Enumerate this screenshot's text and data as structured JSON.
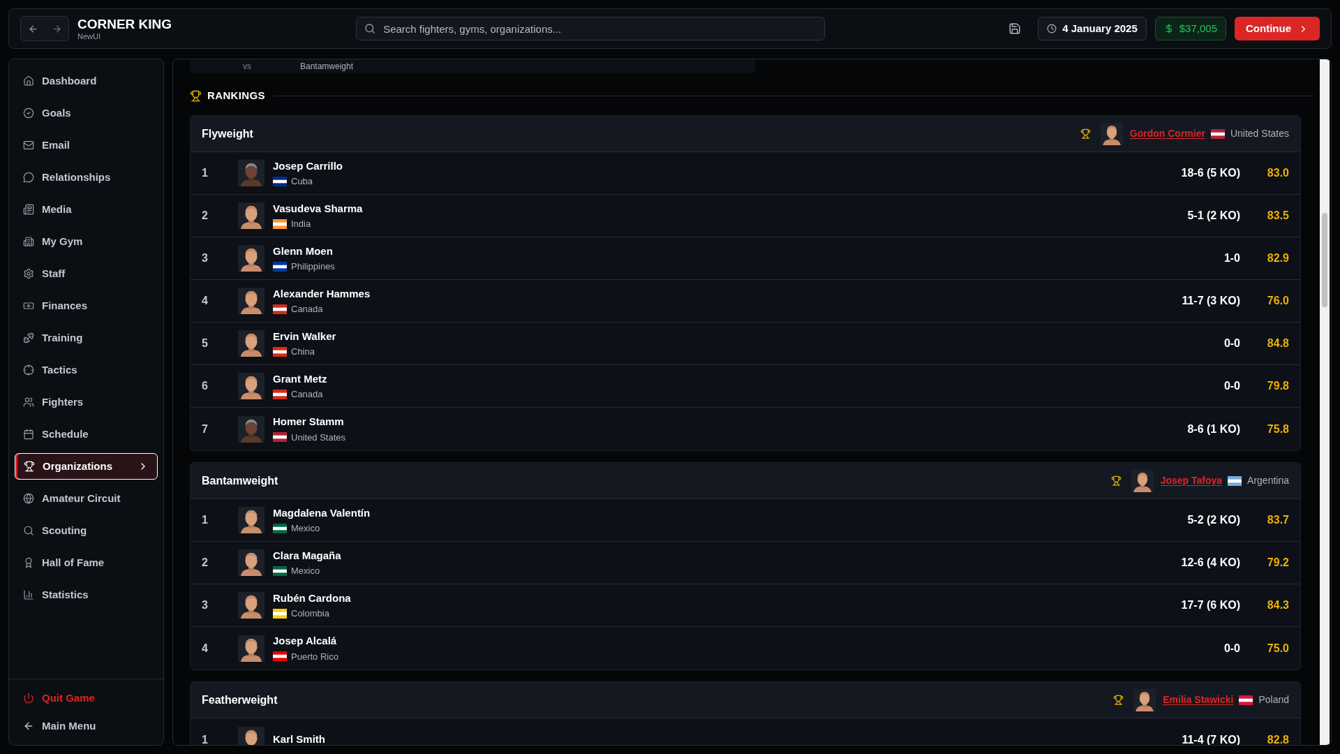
{
  "top_bar": {
    "title": "CORNER KING",
    "subtitle": "NewUI",
    "search": {
      "placeholder": "Search fighters, gyms, organizations..."
    },
    "date": "4 January 2025",
    "money": "$37,005",
    "continue": "Continue"
  },
  "sidebar": {
    "items": [
      {
        "label": "Dashboard",
        "selected": false
      },
      {
        "label": "Goals",
        "selected": false
      },
      {
        "label": "Email",
        "selected": false
      },
      {
        "label": "Relationships",
        "selected": false
      },
      {
        "label": "Media",
        "selected": false
      },
      {
        "label": "My Gym",
        "selected": false
      },
      {
        "label": "Staff",
        "selected": false
      },
      {
        "label": "Finances",
        "selected": false
      },
      {
        "label": "Training",
        "selected": false
      },
      {
        "label": "Tactics",
        "selected": false
      },
      {
        "label": "Fighters",
        "selected": false
      },
      {
        "label": "Schedule",
        "selected": false
      },
      {
        "label": "Organizations",
        "selected": true
      },
      {
        "label": "Amateur Circuit",
        "selected": false
      },
      {
        "label": "Scouting",
        "selected": false
      },
      {
        "label": "Hall of Fame",
        "selected": false
      },
      {
        "label": "Statistics",
        "selected": false
      }
    ],
    "footer": [
      {
        "label": "Quit Game",
        "kind": "danger"
      },
      {
        "label": "Main Menu",
        "kind": "plain"
      }
    ]
  },
  "upcoming_row": {
    "vs": "vs",
    "division": "Bantamweight"
  },
  "rankings": {
    "title": "RANKINGS",
    "divisions": [
      {
        "name": "Flyweight",
        "champion": {
          "name": "Gordon Cormier",
          "country": "United States",
          "color": "#b22234"
        },
        "fighters": [
          {
            "rank": "1",
            "name": "Josep Carrillo",
            "country": "Cuba",
            "color": "#002a8f",
            "record": "18-6 (5 KO)",
            "rating": "83.0"
          },
          {
            "rank": "2",
            "name": "Vasudeva Sharma",
            "country": "India",
            "color": "#ff9933",
            "record": "5-1 (2 KO)",
            "rating": "83.5"
          },
          {
            "rank": "3",
            "name": "Glenn Moen",
            "country": "Philippines",
            "color": "#0038a8",
            "record": "1-0",
            "rating": "82.9"
          },
          {
            "rank": "4",
            "name": "Alexander Hammes",
            "country": "Canada",
            "color": "#d52b1e",
            "record": "11-7 (3 KO)",
            "rating": "76.0"
          },
          {
            "rank": "5",
            "name": "Ervin Walker",
            "country": "China",
            "color": "#de2910",
            "record": "0-0",
            "rating": "84.8"
          },
          {
            "rank": "6",
            "name": "Grant Metz",
            "country": "Canada",
            "color": "#d52b1e",
            "record": "0-0",
            "rating": "79.8"
          },
          {
            "rank": "7",
            "name": "Homer Stamm",
            "country": "United States",
            "color": "#b22234",
            "record": "8-6 (1 KO)",
            "rating": "75.8"
          }
        ]
      },
      {
        "name": "Bantamweight",
        "champion": {
          "name": "Josep Tafoya",
          "country": "Argentina",
          "color": "#74acdf"
        },
        "fighters": [
          {
            "rank": "1",
            "name": "Magdalena Valentín",
            "country": "Mexico",
            "color": "#006847",
            "record": "5-2 (2 KO)",
            "rating": "83.7"
          },
          {
            "rank": "2",
            "name": "Clara Magaña",
            "country": "Mexico",
            "color": "#006847",
            "record": "12-6 (4 KO)",
            "rating": "79.2"
          },
          {
            "rank": "3",
            "name": "Rubén Cardona",
            "country": "Colombia",
            "color": "#fcd116",
            "record": "17-7 (6 KO)",
            "rating": "84.3"
          },
          {
            "rank": "4",
            "name": "Josep Alcalá",
            "country": "Puerto Rico",
            "color": "#ed0000",
            "record": "0-0",
            "rating": "75.0"
          }
        ]
      },
      {
        "name": "Featherweight",
        "champion": {
          "name": "Emilia Stawicki",
          "country": "Poland",
          "color": "#dc143c"
        },
        "fighters": [
          {
            "rank": "1",
            "name": "Karl Smith",
            "record": "11-4 (7 KO)",
            "rating": "82.8"
          }
        ]
      }
    ]
  }
}
